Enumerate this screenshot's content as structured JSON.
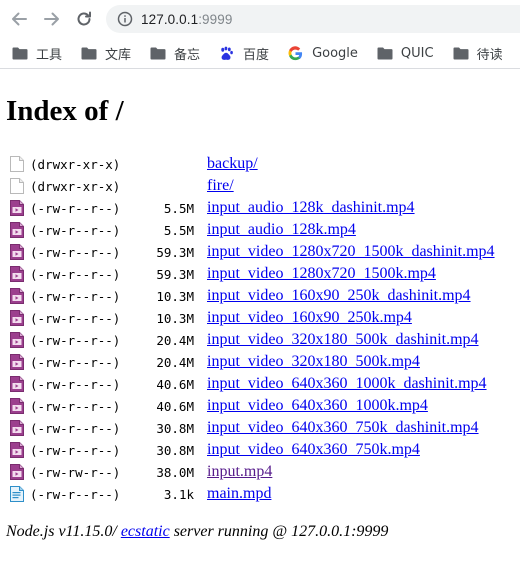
{
  "browser": {
    "url_host": "127.0.0.1",
    "url_port": ":9999",
    "bookmarks": [
      {
        "label": "工具",
        "icon": "folder-icon"
      },
      {
        "label": "文库",
        "icon": "folder-icon"
      },
      {
        "label": "备忘",
        "icon": "folder-icon"
      },
      {
        "label": "百度",
        "icon": "baidu-icon"
      },
      {
        "label": "Google",
        "icon": "google-icon"
      },
      {
        "label": "QUIC",
        "icon": "folder-icon"
      },
      {
        "label": "待读",
        "icon": "folder-icon"
      }
    ]
  },
  "page": {
    "heading": "Index of /",
    "entries": [
      {
        "icon": "file-icon",
        "perm": "(drwxr-xr-x)",
        "size": "",
        "name": "backup/",
        "visited": false
      },
      {
        "icon": "file-icon",
        "perm": "(drwxr-xr-x)",
        "size": "",
        "name": "fire/",
        "visited": false
      },
      {
        "icon": "video-file-icon",
        "perm": "(-rw-r--r--)",
        "size": "5.5M",
        "name": "input_audio_128k_dashinit.mp4",
        "visited": false
      },
      {
        "icon": "video-file-icon",
        "perm": "(-rw-r--r--)",
        "size": "5.5M",
        "name": "input_audio_128k.mp4",
        "visited": false
      },
      {
        "icon": "video-file-icon",
        "perm": "(-rw-r--r--)",
        "size": "59.3M",
        "name": "input_video_1280x720_1500k_dashinit.mp4",
        "visited": false
      },
      {
        "icon": "video-file-icon",
        "perm": "(-rw-r--r--)",
        "size": "59.3M",
        "name": "input_video_1280x720_1500k.mp4",
        "visited": false
      },
      {
        "icon": "video-file-icon",
        "perm": "(-rw-r--r--)",
        "size": "10.3M",
        "name": "input_video_160x90_250k_dashinit.mp4",
        "visited": false
      },
      {
        "icon": "video-file-icon",
        "perm": "(-rw-r--r--)",
        "size": "10.3M",
        "name": "input_video_160x90_250k.mp4",
        "visited": false
      },
      {
        "icon": "video-file-icon",
        "perm": "(-rw-r--r--)",
        "size": "20.4M",
        "name": "input_video_320x180_500k_dashinit.mp4",
        "visited": false
      },
      {
        "icon": "video-file-icon",
        "perm": "(-rw-r--r--)",
        "size": "20.4M",
        "name": "input_video_320x180_500k.mp4",
        "visited": false
      },
      {
        "icon": "video-file-icon",
        "perm": "(-rw-r--r--)",
        "size": "40.6M",
        "name": "input_video_640x360_1000k_dashinit.mp4",
        "visited": false
      },
      {
        "icon": "video-file-icon",
        "perm": "(-rw-r--r--)",
        "size": "40.6M",
        "name": "input_video_640x360_1000k.mp4",
        "visited": false
      },
      {
        "icon": "video-file-icon",
        "perm": "(-rw-r--r--)",
        "size": "30.8M",
        "name": "input_video_640x360_750k_dashinit.mp4",
        "visited": false
      },
      {
        "icon": "video-file-icon",
        "perm": "(-rw-r--r--)",
        "size": "30.8M",
        "name": "input_video_640x360_750k.mp4",
        "visited": false
      },
      {
        "icon": "video-file-icon",
        "perm": "(-rw-rw-r--)",
        "size": "38.0M",
        "name": "input.mp4",
        "visited": true
      },
      {
        "icon": "text-file-icon",
        "perm": "(-rw-r--r--)",
        "size": "3.1k",
        "name": "main.mpd",
        "visited": false
      }
    ],
    "footer": {
      "prefix": "Node.js v11.15.0/ ",
      "link": "ecstatic",
      "suffix": " server running @ 127.0.0.1:9999"
    }
  },
  "colors": {
    "link": "#0000ee",
    "visited": "#551a8b",
    "video_icon": "#9c3f8e",
    "text_icon": "#2e8fc9"
  }
}
